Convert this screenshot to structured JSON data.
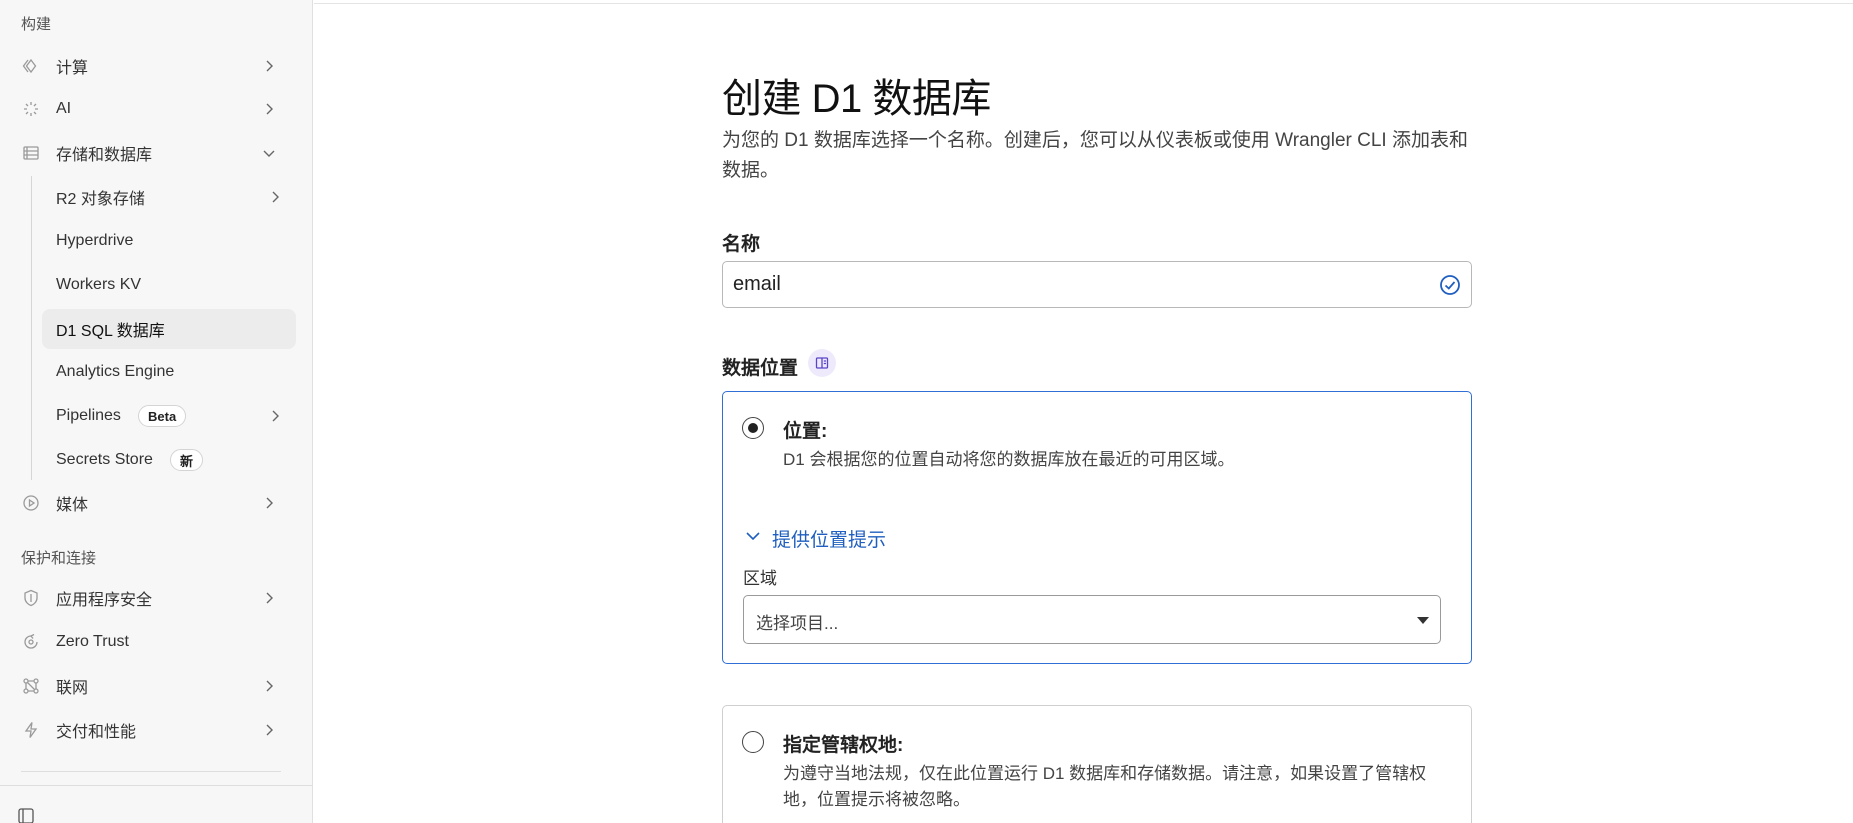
{
  "sidebar": {
    "section_build": "构建",
    "items_top": [
      {
        "label": "计算",
        "icon": "compute-icon"
      },
      {
        "label": "AI",
        "icon": "ai-sparkle-icon"
      },
      {
        "label": "存储和数据库",
        "icon": "storage-icon"
      }
    ],
    "storage_sub": [
      {
        "label": "R2 对象存储"
      },
      {
        "label": "Hyperdrive"
      },
      {
        "label": "Workers KV"
      },
      {
        "label": "D1 SQL 数据库"
      },
      {
        "label": "Analytics Engine"
      },
      {
        "label": "Pipelines",
        "badge": "Beta"
      },
      {
        "label": "Secrets Store",
        "badge": "新"
      }
    ],
    "media": {
      "label": "媒体",
      "icon": "media-play-icon"
    },
    "section_protect": "保护和连接",
    "items_protect": [
      {
        "label": "应用程序安全",
        "icon": "shield-icon"
      },
      {
        "label": "Zero Trust",
        "icon": "zero-trust-icon"
      },
      {
        "label": "联网",
        "icon": "network-icon"
      },
      {
        "label": "交付和性能",
        "icon": "bolt-icon"
      }
    ]
  },
  "main": {
    "title": "创建 D1 数据库",
    "description": "为您的 D1 数据库选择一个名称。创建后，您可以从仪表板或使用 Wrangler CLI 添加表和数据。",
    "name_label": "名称",
    "name_value": "email",
    "location_label": "数据位置",
    "option_location": {
      "title": "位置:",
      "text": "D1 会根据您的位置自动将您的数据库放在最近的可用区域。",
      "hint_toggle": "提供位置提示",
      "region_label": "区域",
      "region_placeholder": "选择项目..."
    },
    "option_jurisdiction": {
      "title": "指定管辖权地:",
      "text": "为遵守当地法规，仅在此位置运行 D1 数据库和存储数据。请注意，如果设置了管辖权地，位置提示将被忽略。"
    }
  },
  "colors": {
    "accent": "#2f6fd6",
    "link": "#1f5fbf",
    "sidebar_bg": "#f7f7f7"
  }
}
